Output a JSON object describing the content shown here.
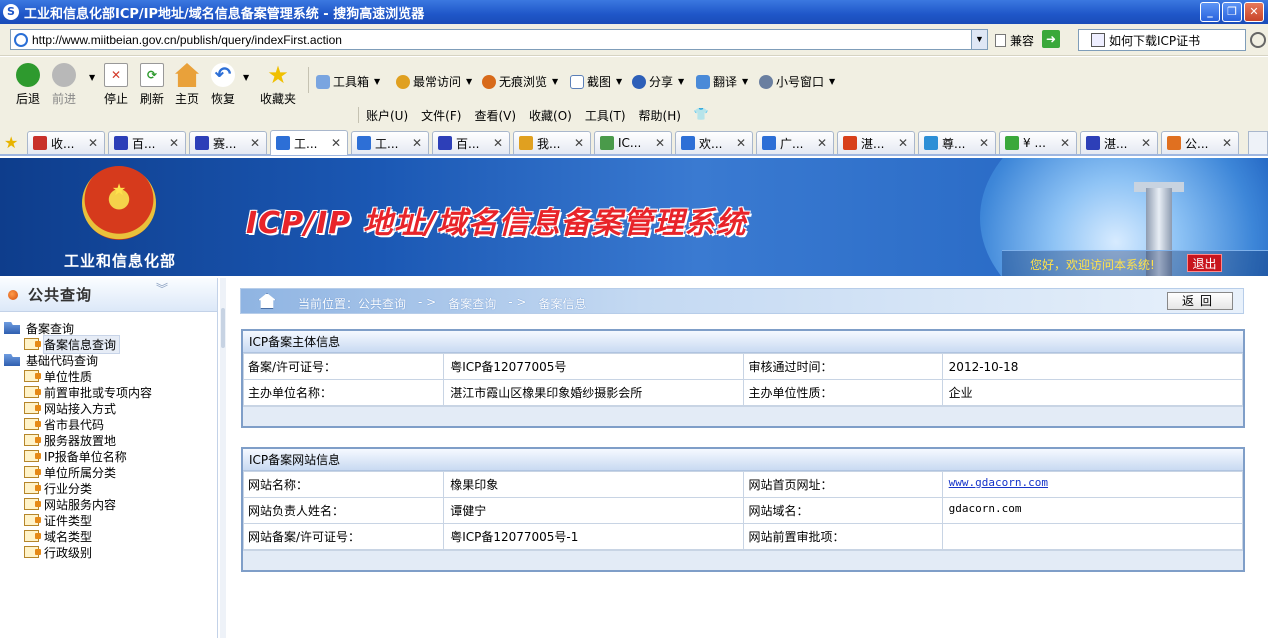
{
  "window": {
    "title": "工业和信息化部ICP/IP地址/域名信息备案管理系统 - 搜狗高速浏览器",
    "buttons": [
      "_",
      "❐",
      "✕"
    ]
  },
  "address": {
    "url": "http://www.miitbeian.gov.cn/publish/query/indexFirst.action",
    "compat_label": "兼容",
    "search_text": "如何下载ICP证书"
  },
  "toolbar": {
    "nav": [
      {
        "label": "后退",
        "color": "#2e9a2e"
      },
      {
        "label": "前进",
        "color": "#a0a0a0"
      },
      {
        "label": "停止",
        "color": "#d33a2a"
      },
      {
        "label": "刷新",
        "color": "#2e9a2e"
      },
      {
        "label": "主页",
        "color": "#e08a1a"
      },
      {
        "label": "恢复",
        "color": "#2d6fd6"
      },
      {
        "label": "收藏夹",
        "color": "#f0c000"
      }
    ],
    "tools": [
      {
        "label": "工具箱",
        "color": "#5a8fd8"
      },
      {
        "label": "最常访问",
        "color": "#e0a020"
      },
      {
        "label": "无痕浏览",
        "color": "#d86a1a"
      },
      {
        "label": "截图",
        "color": "#5a7fb8"
      },
      {
        "label": "分享",
        "color": "#2d5fb8"
      },
      {
        "label": "翻译",
        "color": "#4a8ad8"
      },
      {
        "label": "小号窗口",
        "color": "#6a7fa0"
      }
    ],
    "menu": [
      "账户(U)",
      "文件(F)",
      "查看(V)",
      "收藏(O)",
      "工具(T)",
      "帮助(H)"
    ]
  },
  "tabs": [
    {
      "label": "收...",
      "color": "#c8302a"
    },
    {
      "label": "百...",
      "color": "#2d3fb8"
    },
    {
      "label": "赛...",
      "color": "#2d3fb8"
    },
    {
      "label": "工...",
      "color": "#2d6fd6",
      "active": true
    },
    {
      "label": "工...",
      "color": "#2d6fd6"
    },
    {
      "label": "百...",
      "color": "#2d3fb8"
    },
    {
      "label": "我...",
      "color": "#e0a020"
    },
    {
      "label": "IC...",
      "color": "#4a9a4a"
    },
    {
      "label": "欢...",
      "color": "#2d6fd6"
    },
    {
      "label": "广...",
      "color": "#2d6fd6"
    },
    {
      "label": "湛...",
      "color": "#d8401a"
    },
    {
      "label": "尊...",
      "color": "#2d8fd6"
    },
    {
      "label": "¥ ...",
      "color": "#3aa83a"
    },
    {
      "label": "湛...",
      "color": "#2d3fb8"
    },
    {
      "label": "公...",
      "color": "#e07020"
    }
  ],
  "banner": {
    "ministry": "工业和信息化部",
    "system_title": "ICP/IP 地址/域名信息备案管理系统",
    "welcome": "您好，欢迎访问本系统!",
    "logout": "退出"
  },
  "sidebar": {
    "title": "公共查询",
    "groups": [
      {
        "label": "备案查询",
        "items": [
          "备案信息查询"
        ]
      },
      {
        "label": "基础代码查询",
        "items": [
          "单位性质",
          "前置审批或专项内容",
          "网站接入方式",
          "省市县代码",
          "服务器放置地",
          "IP报备单位名称",
          "单位所属分类",
          "行业分类",
          "网站服务内容",
          "证件类型",
          "域名类型",
          "行政级别"
        ]
      }
    ]
  },
  "breadcrumb": {
    "prefix": "当前位置：公共查询",
    "sep1": "- >",
    "level2": "备案查询",
    "sep2": "- >",
    "level3": "备案信息",
    "back": "返回"
  },
  "subject": {
    "title": "ICP备案主体信息",
    "rows": [
      {
        "l1": "备案/许可证号：",
        "v1": "粤ICP备12077005号",
        "l2": "审核通过时间：",
        "v2": "2012-10-18"
      },
      {
        "l1": "主办单位名称：",
        "v1": "湛江市霞山区橡果印象婚纱摄影会所",
        "l2": "主办单位性质：",
        "v2": "企业"
      }
    ]
  },
  "website": {
    "title": "ICP备案网站信息",
    "rows": [
      {
        "l1": "网站名称：",
        "v1": "橡果印象",
        "l2": "网站首页网址：",
        "v2": "www.gdacorn.com"
      },
      {
        "l1": "网站负责人姓名：",
        "v1": "谭健宁",
        "l2": "网站域名：",
        "v2": "gdacorn.com"
      },
      {
        "l1": "网站备案/许可证号：",
        "v1": "粤ICP备12077005号-1",
        "l2": "网站前置审批项：",
        "v2": ""
      }
    ]
  }
}
